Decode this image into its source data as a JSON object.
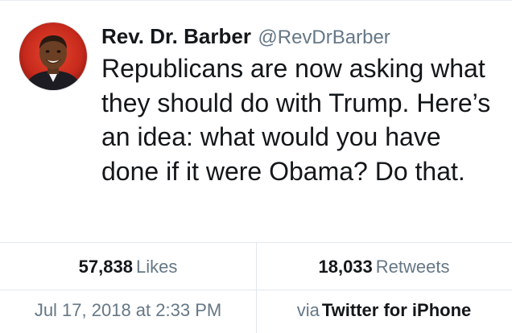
{
  "tweet": {
    "author": {
      "display_name": "Rev. Dr. Barber",
      "handle": "@RevDrBarber"
    },
    "text": "Republicans are now asking what they should do with Trump. Here’s an idea: what would you have done if it were Obama? Do that."
  },
  "stats": {
    "likes_count": "57,838",
    "likes_label": "Likes",
    "retweets_count": "18,033",
    "retweets_label": "Retweets"
  },
  "meta": {
    "timestamp": "Jul 17, 2018 at 2:33 PM",
    "via_label": "via",
    "source": "Twitter for iPhone"
  },
  "colors": {
    "text_primary": "#14171a",
    "text_secondary": "#657786",
    "divider": "#e1e8ed"
  }
}
